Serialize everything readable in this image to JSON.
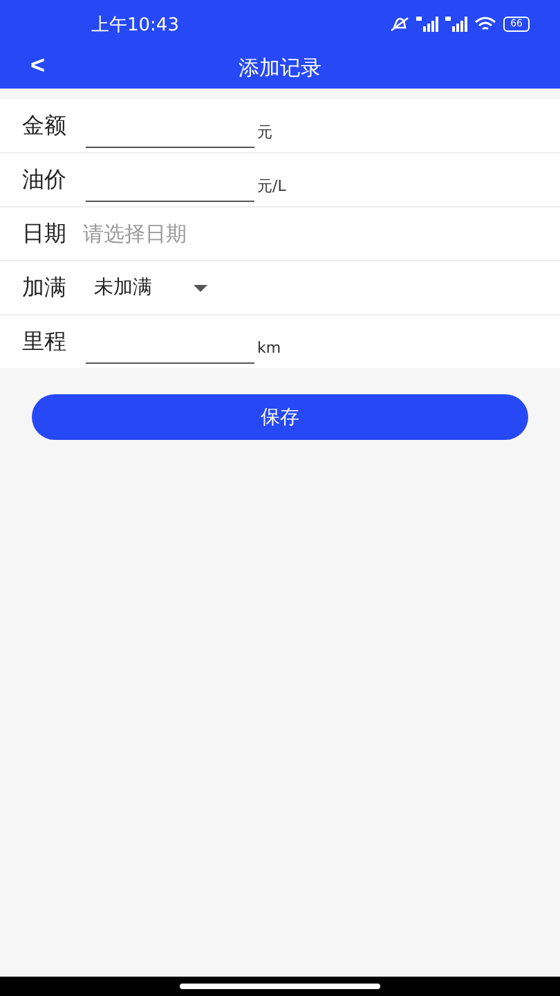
{
  "status_bar": {
    "time": "上午10:43",
    "battery": "66"
  },
  "header": {
    "back": "<",
    "title": "添加记录"
  },
  "fields": [
    {
      "kind": "input",
      "label": "金额",
      "unit": "元"
    },
    {
      "kind": "input",
      "label": "油价",
      "unit": "元/L"
    },
    {
      "kind": "picker",
      "label": "日期",
      "placeholder": "请选择日期"
    },
    {
      "kind": "select",
      "label": "加满",
      "value": "未加满"
    },
    {
      "kind": "input",
      "label": "里程",
      "unit": "km"
    }
  ],
  "save_button": "保存"
}
